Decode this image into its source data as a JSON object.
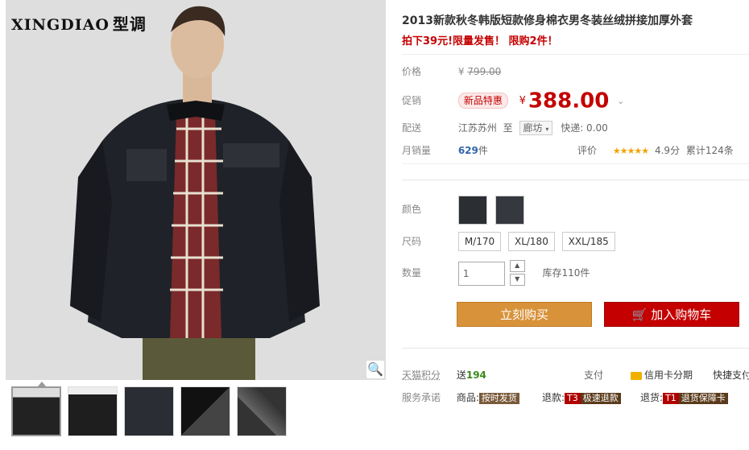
{
  "brand": {
    "latin": "XINGDIAO",
    "cn": "型调"
  },
  "product": {
    "title": "2013新款秋冬韩版短款修身棉衣男冬装丝绒拼接加厚外套",
    "subtitle": "拍下39元!限量发售！ 限购2件！"
  },
  "price": {
    "label": "价格",
    "currency": "¥",
    "original": "799.00",
    "promo_label": "促销",
    "promo_badge": "新品特惠",
    "promo_price": "388.00"
  },
  "shipping": {
    "label": "配送",
    "from": "江苏苏州",
    "to_word": "至",
    "dest": "廊坊",
    "express": "快递: 0.00"
  },
  "sales": {
    "label": "月销量",
    "count": "629",
    "unit": "件",
    "review_label": "评价",
    "stars": "★★★★★",
    "score": "4.9分",
    "total": "累计124条"
  },
  "options": {
    "color_label": "颜色",
    "size_label": "尺码",
    "sizes": [
      "M/170",
      "XL/180",
      "XXL/185"
    ],
    "qty_label": "数量",
    "qty_value": "1",
    "stock": "库存110件"
  },
  "buttons": {
    "buy": "立刻购买",
    "cart": "加入购物车"
  },
  "footer": {
    "points_label": "天猫积分",
    "points_give": "送",
    "points_value": "194",
    "pay_label": "支付",
    "credit": "信用卡分期",
    "quick_pay": "快捷支付",
    "service_label": "服务承诺",
    "goods_label": "商品:",
    "goods_tag": "按时发货",
    "refund_label": "退款:",
    "refund_code": "T3",
    "refund_tag": "极速退款",
    "return_label": "退货:",
    "return_code": "T1",
    "return_tag": "退货保障卡"
  },
  "icons": [
    "zoom-icon",
    "cart-icon",
    "chevron-down-icon",
    "stepper-up-icon",
    "stepper-down-icon",
    "credit-card-icon"
  ],
  "colors": {
    "accent_red": "#c40000",
    "buy_orange": "#d8923a"
  }
}
